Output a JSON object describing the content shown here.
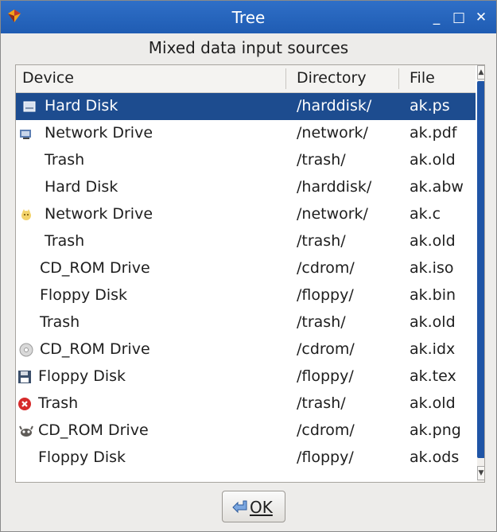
{
  "window": {
    "title": "Tree"
  },
  "title_buttons": {
    "minimize": "_",
    "maximize": "□",
    "close": "✕"
  },
  "subtitle": "Mixed data input sources",
  "columns": {
    "device": "Device",
    "directory": "Directory",
    "file": "File"
  },
  "rows": [
    {
      "device": "Hard Disk",
      "directory": "/harddisk/",
      "file": "ak.ps",
      "icon": "hard-disk-icon",
      "selected": true
    },
    {
      "device": "Network Drive",
      "directory": "/network/",
      "file": "ak.pdf",
      "icon": "network-drive-icon"
    },
    {
      "device": "Trash",
      "directory": "/trash/",
      "file": "ak.old",
      "icon": ""
    },
    {
      "device": "Hard Disk",
      "directory": "/harddisk/",
      "file": "ak.abw",
      "icon": ""
    },
    {
      "device": "Network Drive",
      "directory": "/network/",
      "file": "ak.c",
      "icon": "cat-emblem-icon"
    },
    {
      "device": "Trash",
      "directory": "/trash/",
      "file": "ak.old",
      "icon": ""
    },
    {
      "device": "CD_ROM Drive",
      "directory": "/cdrom/",
      "file": "ak.iso",
      "icon": ""
    },
    {
      "device": "Floppy Disk",
      "directory": "/floppy/",
      "file": "ak.bin",
      "icon": ""
    },
    {
      "device": "Trash",
      "directory": "/trash/",
      "file": "ak.old",
      "icon": ""
    },
    {
      "device": "CD_ROM Drive",
      "directory": "/cdrom/",
      "file": "ak.idx",
      "icon": "cdrom-icon"
    },
    {
      "device": "Floppy Disk",
      "directory": "/floppy/",
      "file": "ak.tex",
      "icon": "floppy-icon"
    },
    {
      "device": "Trash",
      "directory": "/trash/",
      "file": "ak.old",
      "icon": "stop-icon"
    },
    {
      "device": "CD_ROM Drive",
      "directory": "/cdrom/",
      "file": "ak.png",
      "icon": "gimp-icon"
    },
    {
      "device": "Floppy Disk",
      "directory": "/floppy/",
      "file": "ak.ods",
      "icon": ""
    }
  ],
  "ok_button": {
    "label": "OK"
  },
  "colors": {
    "titlebar": "#2062bb",
    "selection": "#1d4c8f",
    "scrollbar_thumb": "#1f55a6"
  }
}
